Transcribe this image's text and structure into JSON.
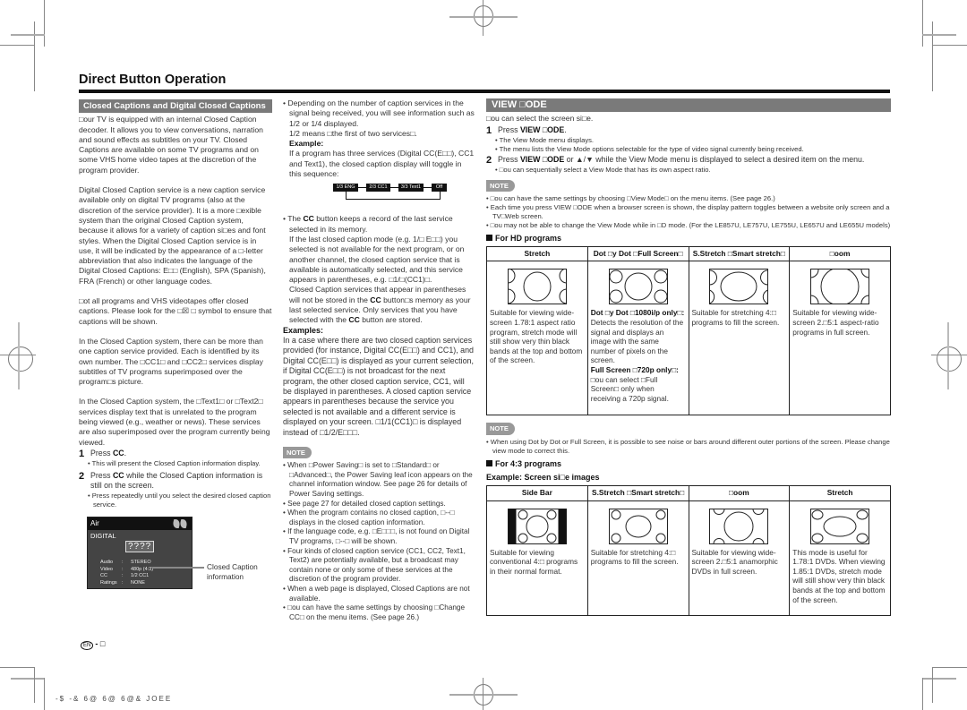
{
  "page_title": "Direct Button Operation",
  "closed_captions": {
    "section_title": "Closed Captions and Digital Closed Captions",
    "para1": "□our TV is equipped with an internal Closed Caption decoder. It allows you to view conversations, narration and sound effects as subtitles on your TV. Closed Captions are available on some TV programs and on some VHS home video tapes at the discretion of the program provider.",
    "para2": "Digital Closed Caption service is a new caption service available only on digital TV programs (also at the discretion of the service provider). It is a more □exible system than the original Closed Caption system, because it allows for a variety of caption si□es and font styles. When the Digital Closed Caption service is in use, it will be indicated by the appearance of a □-letter abbreviation that also indicates the language of the Digital Closed Captions: E□□ (English), SPA (Spanish), FRA (French) or other language codes.",
    "para3": "□ot all programs and VHS videotapes offer closed captions. Please look for the □☒ □ symbol to ensure that captions will be shown.",
    "para4": "In the Closed Caption system, there can be more than one caption service provided. Each is identified by its own number. The □CC1□ and □CC2□ services display subtitles of TV programs superimposed over the program□s picture.",
    "para5": "In the Closed Caption system, the □Text1□ or □Text2□ services display text that is unrelated to the program being viewed (e.g., weather or news). These services are also superimposed over the program currently being viewed.",
    "steps": [
      {
        "num": "1",
        "pre": "Press ",
        "bold": "CC",
        "post": ".",
        "sub": "This will present the Closed Caption information display."
      },
      {
        "num": "2",
        "pre": "Press ",
        "bold": "CC",
        "post": " while the Closed Caption information is still on the screen.",
        "sub": "Press repeatedly until you select the desired closed caption service."
      }
    ],
    "tv_window": {
      "source": "Air",
      "mode": "DIGITAL",
      "channel": "????",
      "rows": [
        {
          "key": "Audio",
          "value": "STEREO"
        },
        {
          "key": "Video",
          "value": "480p (4:3)"
        },
        {
          "key": "CC",
          "value": "1/2 CC1"
        },
        {
          "key": "Ratings",
          "value": "NONE"
        }
      ],
      "pointer_label": "Closed Caption information"
    }
  },
  "col2": {
    "bullet1": "Depending on the number of caption services in the signal being received, you will see information such as 1/2 or 1/4 displayed.",
    "bullet1_b": "1/2 means □the first of two services□.",
    "example_label": "Example:",
    "example_text": "If a program has three services (Digital CC(E□□), CC1 and Text1), the closed caption display will toggle in this sequence:",
    "sequence": [
      "1/3 ENG",
      "2/3 CC1",
      "3/3 Text1",
      "Off"
    ],
    "bullet2_pre": "The ",
    "bullet2_bold": "CC",
    "bullet2_post": " button keeps a record of the last service selected in its memory.",
    "bullet2_b": "If the last closed caption mode (e.g. 1/□ E□□) you selected is not available for the next program, or on another channel, the closed caption service that is available is automatically selected, and this service appears in parentheses, e.g. □1/□(CC1)□.",
    "bullet2_c_pre": "Closed Caption services that appear in parentheses will not be stored in the ",
    "bullet2_c_bold": "CC",
    "bullet2_c_mid": " button□s memory as your last selected service. Only services that you have selected with the ",
    "bullet2_c_bold2": "CC",
    "bullet2_c_post": " button are stored.",
    "examples_label": "Examples:",
    "examples_text": "In a case where there are two closed caption services provided (for instance, Digital CC(E□□) and CC1), and Digital CC(E□□) is displayed as your current selection, if Digital CC(E□□) is not broadcast for the next program, the other closed caption service, CC1, will be displayed in parentheses. A closed caption service appears in parentheses because the service you selected is not available and a different service is displayed on your screen. □1/1(CC1)□ is displayed instead of □1/2/E□□□.",
    "note_label": "NOTE",
    "notes": [
      "When □Power Saving□ is set to □Standard□ or □Advanced□, the Power Saving leaf icon appears on the channel information window. See page 26 for details of Power Saving settings.",
      "See page 27 for detailed closed caption settings.",
      "When the program contains no closed caption, □--□ displays in the closed caption information.",
      "If the language code, e.g. □E□□□, is not found on Digital TV programs, □--□ will be shown.",
      "Four kinds of closed caption service (CC1, CC2, Text1, Text2) are potentially available, but a broadcast may contain none or only some of these services at the discretion of the program provider.",
      "When a web page is displayed, Closed Captions are not available.",
      "□ou can have the same settings by choosing □Change CC□ on the menu items. (See page 26.)"
    ]
  },
  "view_mode": {
    "section_title": "VIEW □ODE",
    "intro": "□ou can select the screen si□e.",
    "steps": [
      {
        "num": "1",
        "pre": "Press ",
        "bold": "VIEW □ODE",
        "post": ".",
        "subs": [
          "The View Mode menu displays.",
          "The menu lists the View Mode options selectable for the type of video signal currently being received."
        ]
      },
      {
        "num": "2",
        "pre": "Press ",
        "bold": "VIEW □ODE",
        "post": " or ▲/▼ while the View Mode menu is displayed to select a desired item on the menu.",
        "subs": [
          "□ou can sequentially select a View Mode that has its own aspect ratio."
        ]
      }
    ],
    "note_label": "NOTE",
    "notes": [
      "□ou can have the same settings by choosing □View Mode□ on the menu items. (See page 26.)",
      "Each time you press VIEW □ODE when a browser screen is shown, the display pattern toggles between a website only screen and a TV□Web screen.",
      "□ou may not be able to change the View Mode while in □D mode. (For the LE857U, LE757U, LE755U, LE657U and LE655U models)"
    ],
    "hd_heading": "For HD programs",
    "hd_table": {
      "headers": [
        "Stretch",
        "Dot □y Dot □Full Screen□",
        "S.Stretch □Smart stretch□",
        "□oom"
      ],
      "cells": [
        "Suitable for viewing wide-screen 1.78:1 aspect ratio program, stretch mode will still show very thin black bands at the top and bottom of the screen.",
        "",
        "Suitable for stretching 4:□ programs to fill the screen.",
        "Suitable for viewing wide-screen 2.□5:1 aspect-ratio programs in full screen."
      ],
      "dotbydot": {
        "b1": "Dot □y Dot □1080i/p only□:",
        "t1": " Detects the resolution of the signal and displays an image with the same number of pixels on the screen.",
        "b2": "Full Screen □720p only□:",
        "t2": " □ou can select □Full Screen□ only when receiving a 720p signal."
      }
    },
    "note2_label": "NOTE",
    "note2": "When using Dot by Dot or Full Screen, it is possible to see noise or bars around different outer portions of the screen. Please change view mode to correct this.",
    "sd_heading": "For 4:3 programs",
    "sd_subheading": "Example: Screen si□e images",
    "sd_table": {
      "headers": [
        "Side Bar",
        "S.Stretch □Smart stretch□",
        "□oom",
        "Stretch"
      ],
      "cells": [
        "Suitable for viewing conventional 4:□ programs in their normal format.",
        "Suitable for stretching 4:□ programs to fill the screen.",
        "Suitable for viewing wide-screen 2.□5:1 anamorphic DVDs in full screen.",
        "This mode is useful for 1.78:1 DVDs. When viewing 1.85:1 DVDs, stretch mode will still show very thin black bands at the top and bottom of the screen."
      ]
    }
  },
  "footer": {
    "lang": "EN",
    "page": "- □",
    "code": "-$  -&  6@  6@  6@& JOEE"
  }
}
